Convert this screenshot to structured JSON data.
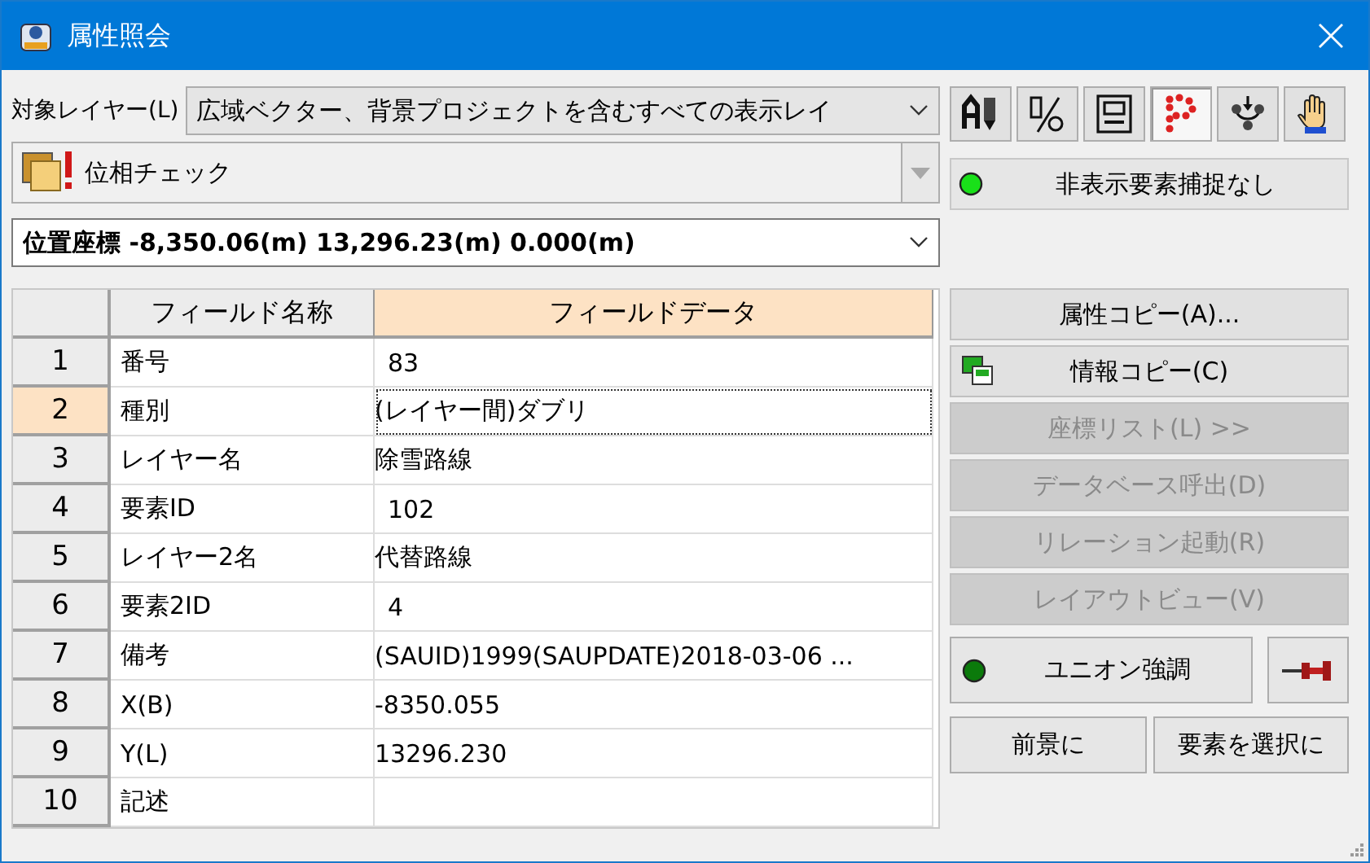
{
  "window": {
    "title": "属性照会"
  },
  "target_layer": {
    "label": "対象レイヤー(L)",
    "value": "広域ベクター、背景プロジェクトを含むすべての表示レイ"
  },
  "toolbar": [
    {
      "selected": false
    },
    {
      "selected": false
    },
    {
      "selected": false
    },
    {
      "selected": true
    },
    {
      "selected": false
    },
    {
      "selected": false
    }
  ],
  "layer_select": {
    "value": "位相チェック",
    "disabled": true
  },
  "hidden_capture": {
    "label": "非表示要素捕捉なし"
  },
  "position": {
    "value": "位置座標 -8,350.06(m) 13,296.23(m) 0.000(m)"
  },
  "grid": {
    "columns": [
      {
        "label": "フィールド名称",
        "selected": false
      },
      {
        "label": "フィールドデータ",
        "selected": true
      }
    ],
    "rows": [
      {
        "number": "1",
        "name": "番号",
        "value": "83",
        "selected": false
      },
      {
        "number": "2",
        "name": "種別",
        "value": "(レイヤー間)ダブリ",
        "selected": true
      },
      {
        "number": "3",
        "name": "レイヤー名",
        "value": "除雪路線",
        "selected": false
      },
      {
        "number": "4",
        "name": "要素ID",
        "value": "102",
        "selected": false
      },
      {
        "number": "5",
        "name": "レイヤー2名",
        "value": "代替路線",
        "selected": false
      },
      {
        "number": "6",
        "name": "要素2ID",
        "value": "4",
        "selected": false
      },
      {
        "number": "7",
        "name": "備考",
        "value": "(SAUID)1999(SAUPDATE)2018-03-06 ...",
        "selected": false
      },
      {
        "number": "8",
        "name": "X(B)",
        "value": "-8350.055",
        "selected": false
      },
      {
        "number": "9",
        "name": "Y(L)",
        "value": "13296.230",
        "selected": false
      },
      {
        "number": "10",
        "name": "記述",
        "selected": false
      }
    ]
  },
  "actions": [
    {
      "label": "属性コピー(A)...",
      "disabled": false,
      "kind": "plain"
    },
    {
      "label": "情報コピー(C)",
      "disabled": false,
      "kind": "icon"
    },
    {
      "label": "座標リスト(L) >>",
      "disabled": true,
      "kind": "plain"
    },
    {
      "label": "データベース呼出(D)",
      "disabled": true,
      "kind": "plain"
    },
    {
      "label": "リレーション起動(R)",
      "disabled": true,
      "kind": "plain"
    },
    {
      "label": "レイアウトビュー(V)",
      "disabled": true,
      "kind": "plain"
    }
  ],
  "union": {
    "label": "ユニオン強調"
  },
  "bottom_buttons": [
    "前景に",
    "要素を選択に"
  ]
}
